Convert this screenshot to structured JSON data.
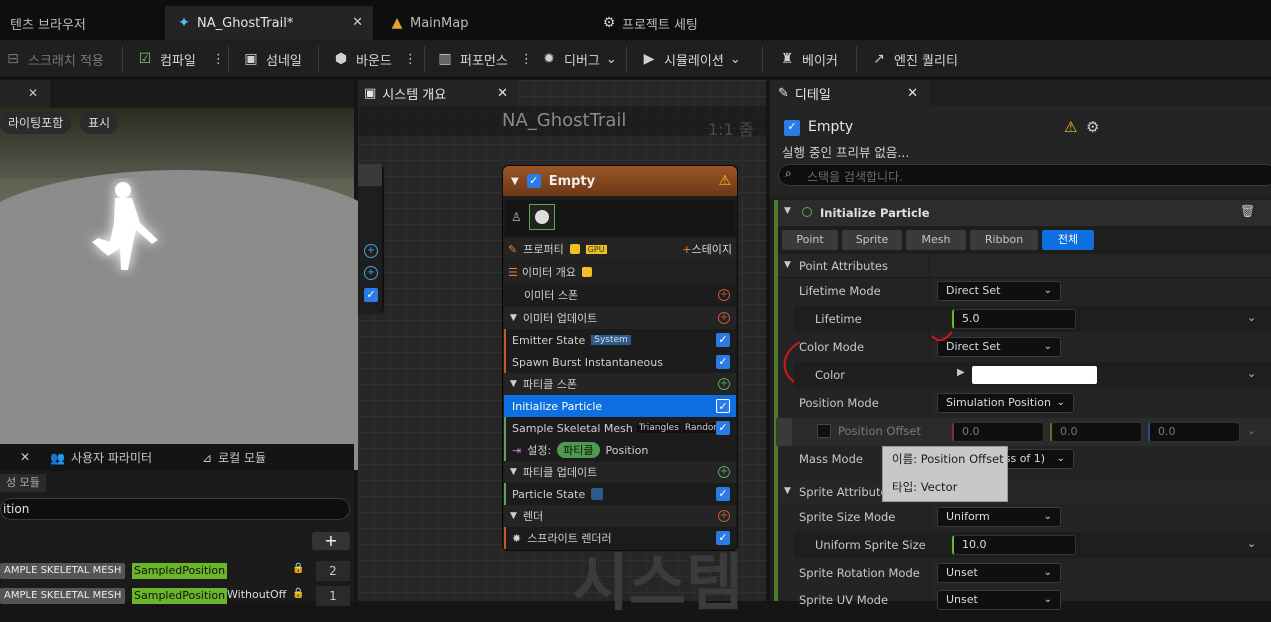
{
  "tabs": [
    {
      "label": "텐츠 브라우저"
    },
    {
      "label": "NA_GhostTrail*"
    },
    {
      "label": "MainMap"
    },
    {
      "label": "프로젝트 세팅"
    }
  ],
  "toolbar": {
    "scratch": "스크래치 적용",
    "compile": "컴파일",
    "thumbnail": "섬네일",
    "bounds": "바운드",
    "performance": "퍼포먼스",
    "debug": "디버그",
    "simulation": "시뮬레이션",
    "baker": "베이커",
    "engine_quality": "엔진 퀄리티"
  },
  "viewport": {
    "lighting": "라이팅포함",
    "show": "표시"
  },
  "bottom_left": {
    "tab_user_params": "사용자 파라미터",
    "tab_local_modules": "로컬 모듈",
    "tab_partial": "성 모듈",
    "search_value": "ition",
    "rows": [
      {
        "source": "AMPLE SKELETAL MESH",
        "name": "SampledPosition",
        "suffix": "",
        "count": "2"
      },
      {
        "source": "AMPLE SKELETAL MESH",
        "name": "SampledPosition",
        "suffix": "WithoutOff",
        "count": "1"
      }
    ]
  },
  "system_panel": {
    "tab": "시스템 개요",
    "title": "NA_GhostTrail",
    "zoom": "1:1 줌",
    "watermark": "시스템"
  },
  "node": {
    "title": "Empty",
    "properties": "프로퍼티",
    "gpu": "GPU",
    "stage": "스테이지",
    "emitter_summary": "이미터 개요",
    "emitter_spawn": "이미터 스폰",
    "emitter_update": "이미터 업데이트",
    "emitter_state": "Emitter State",
    "system_badge": "System",
    "spawn_burst": "Spawn Burst Instantaneous",
    "particle_spawn": "파티클 스폰",
    "init_particle": "Initialize Particle",
    "sample_mesh": "Sample Skeletal Mesh",
    "triangles": "Triangles",
    "random": "Random",
    "set_label": "설정:",
    "particle_pill": "파티클",
    "position": "Position",
    "particle_update": "파티클 업데이트",
    "particle_state": "Particle State",
    "render": "렌더",
    "sprite_renderer": "스프라이트 렌더러"
  },
  "details": {
    "tab": "디테일",
    "emitter": "Empty",
    "no_preview": "실행 중인 프리뷰 없음...",
    "search_placeholder": "스택을 검색합니다.",
    "section": "Initialize Particle",
    "filters": [
      "Point",
      "Sprite",
      "Mesh",
      "Ribbon",
      "전체"
    ],
    "point_attributes": "Point Attributes",
    "lifetime_mode": "Lifetime Mode",
    "lifetime_mode_val": "Direct Set",
    "lifetime": "Lifetime",
    "lifetime_val": "5.0",
    "color_mode": "Color Mode",
    "color_mode_val": "Direct Set",
    "color": "Color",
    "position_mode": "Position Mode",
    "position_mode_val": "Simulation Position",
    "position_offset": "Position Offset",
    "offset_x": "0.0",
    "offset_y": "0.0",
    "offset_z": "0.0",
    "mass_mode": "Mass Mode",
    "mass_mode_val": "ass of 1)",
    "sprite_attributes": "Sprite Attributes",
    "sprite_size_mode": "Sprite Size Mode",
    "sprite_size_mode_val": "Uniform",
    "uniform_sprite_size": "Uniform Sprite Size",
    "uniform_sprite_size_val": "10.0",
    "sprite_rotation_mode": "Sprite Rotation Mode",
    "sprite_rotation_mode_val": "Unset",
    "sprite_uv_mode": "Sprite UV Mode",
    "sprite_uv_mode_val": "Unset"
  },
  "tooltip": {
    "name": "이름: Position Offset",
    "type": "타입: Vector"
  },
  "colors": {
    "accent": "#2c7be5",
    "node_header": "#8a4a20",
    "annotation": "#d01818"
  }
}
